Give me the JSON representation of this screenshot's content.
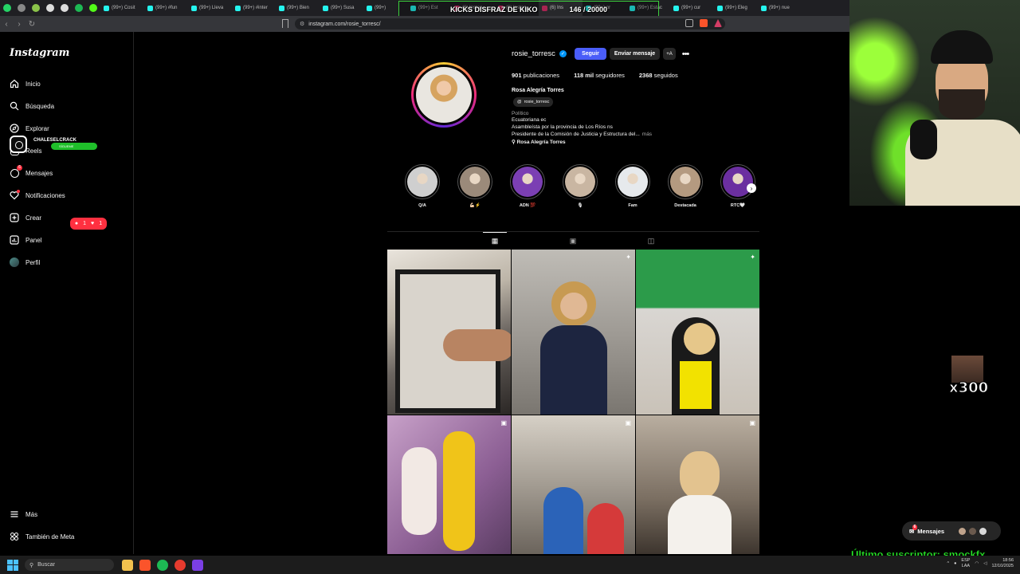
{
  "browser": {
    "tabs": [
      {
        "label": "(99+) Cosit",
        "color": "#25f4ee"
      },
      {
        "label": "(99+) #fun",
        "color": "#25f4ee"
      },
      {
        "label": "(99+) Lleva",
        "color": "#25f4ee"
      },
      {
        "label": "(99+) #inter",
        "color": "#25f4ee"
      },
      {
        "label": "(99+) Bien",
        "color": "#25f4ee"
      },
      {
        "label": "(99+) Susa",
        "color": "#25f4ee"
      },
      {
        "label": "(99+) ",
        "color": "#25f4ee"
      },
      {
        "label": "(99+) Est",
        "color": "#25f4ee"
      },
      {
        "label": "(6) Instag",
        "color": "#e1306c"
      },
      {
        "label": "(6) Instag",
        "color": "#e1306c"
      },
      {
        "label": "(6) Ins",
        "color": "#e1306c",
        "active": true
      },
      {
        "label": "(99+) pr",
        "color": "#25f4ee"
      },
      {
        "label": "(99+) Estac",
        "color": "#25f4ee"
      },
      {
        "label": "(99+) cur",
        "color": "#25f4ee"
      },
      {
        "label": "(99+) Eleg",
        "color": "#25f4ee"
      },
      {
        "label": "(99+) nue",
        "color": "#25f4ee"
      }
    ],
    "stream_title": "KICKS DISFRAZ DE KIKO",
    "stream_goal": "146 / 20000",
    "url": "instagram.com/rosie_torresc/"
  },
  "sidebar": {
    "logo": "Instagram",
    "items": [
      {
        "label": "Inicio",
        "icon": "home-icon"
      },
      {
        "label": "Búsqueda",
        "icon": "search-icon"
      },
      {
        "label": "Explorar",
        "icon": "compass-icon"
      },
      {
        "label": "Reels",
        "icon": "reels-icon"
      },
      {
        "label": "Mensajes",
        "icon": "messenger-icon",
        "badge": "6"
      },
      {
        "label": "Notificaciones",
        "icon": "heart-icon"
      },
      {
        "label": "Crear",
        "icon": "plus-icon"
      },
      {
        "label": "Panel",
        "icon": "dashboard-icon"
      },
      {
        "label": "Perfil",
        "icon": "avatar-icon"
      }
    ],
    "notif_pill": {
      "comments": "1",
      "likes": "1"
    },
    "bottom": [
      {
        "label": "Más",
        "icon": "menu-icon"
      },
      {
        "label": "También de Meta",
        "icon": "meta-icon"
      }
    ],
    "overlay_brand": "CHALESELCRACK",
    "overlay_follow": "SÍGUEME"
  },
  "profile": {
    "username": "rosie_torresc",
    "follow_label": "Seguir",
    "message_label": "Enviar mensaje",
    "add_user_label": "+A",
    "posts_count": "901",
    "posts_label": "publicaciones",
    "followers_count": "118 mil",
    "followers_label": "seguidores",
    "following_count": "2368",
    "following_label": "seguidos",
    "full_name": "Rosa Alegría Torres",
    "threads_handle": "rosie_torresc",
    "category": "Político",
    "bio_line1": "Ecuatoriana ec",
    "bio_line2": "Asambleísta por la provincia de Los Ríos ns",
    "bio_line3": "Presidente de la Comisión de Justicia y Estructura del...",
    "bio_more": "más",
    "bio_link": "Rosa Alegría Torres"
  },
  "highlights": [
    {
      "label": "Q/A",
      "color": "#cfcfcf"
    },
    {
      "label": "💪🏻⚡",
      "color": "#9b8a7a"
    },
    {
      "label": "ADN 💯",
      "color": "#7b3fb3"
    },
    {
      "label": "🎙",
      "color": "#c9b6a2"
    },
    {
      "label": "Fam",
      "color": "#e6e9ec"
    },
    {
      "label": "Destacada",
      "color": "#b49a80"
    },
    {
      "label": "RTC🤍",
      "color": "#6b2fa0"
    }
  ],
  "grid_colors": {
    "p1": "#8e8a86",
    "p2": "#3b4150",
    "p3": "#2e8b3e",
    "p4": "#a67fb0",
    "p5": "#c8c2b8",
    "p6": "#8a7d6e"
  },
  "messages_pill": {
    "label": "Mensajes",
    "badge": "6"
  },
  "subscriber_overlay": "Último suscriptor: smockfx",
  "emote_overlay": "x300",
  "taskbar": {
    "search_placeholder": "Buscar",
    "lang": "ESP",
    "lang2": "LAA",
    "time": "18:56",
    "date": "12/10/2025"
  }
}
